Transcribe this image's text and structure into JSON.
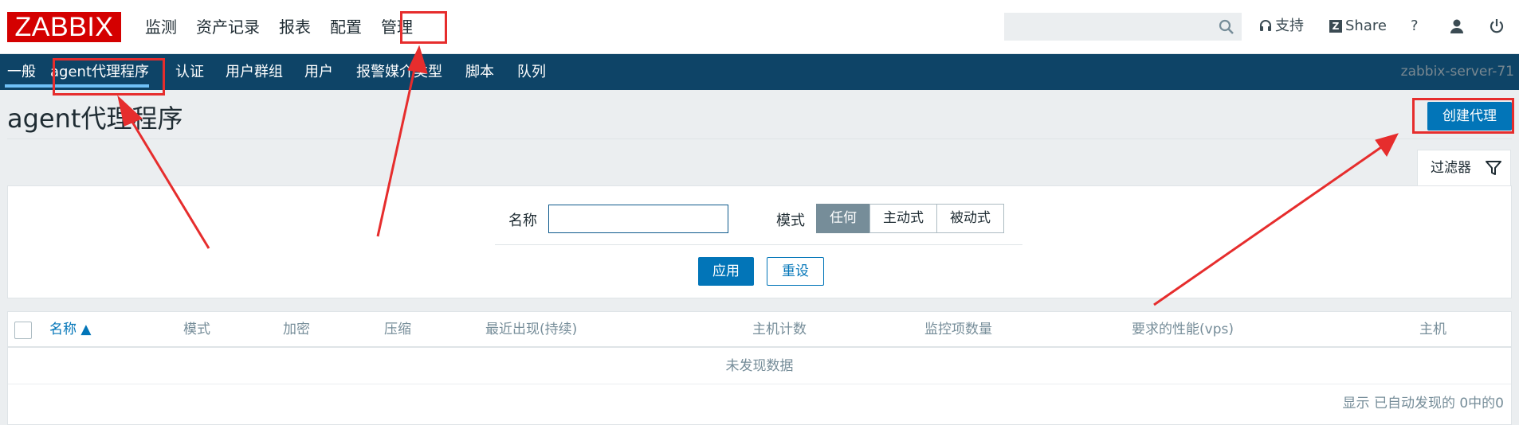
{
  "app": {
    "logo_text": "ZABBIX",
    "server_name": "zabbix-server-71"
  },
  "top_menu": [
    {
      "label": "监测"
    },
    {
      "label": "资产记录"
    },
    {
      "label": "报表"
    },
    {
      "label": "配置"
    },
    {
      "label": "管理",
      "active": true
    }
  ],
  "header_icons": {
    "search_icon": "search-icon",
    "support_label": "支持",
    "share_label": "Share",
    "help_label": "?",
    "user_icon": "user-icon",
    "logout_icon": "power-icon"
  },
  "sub_nav": [
    {
      "label": "一般"
    },
    {
      "label": "agent代理程序",
      "active": true
    },
    {
      "label": "认证"
    },
    {
      "label": "用户群组"
    },
    {
      "label": "用户"
    },
    {
      "label": "报警媒介类型"
    },
    {
      "label": "脚本"
    },
    {
      "label": "队列"
    }
  ],
  "page": {
    "title": "agent代理程序",
    "create_button": "创建代理"
  },
  "filter": {
    "tab_label": "过滤器",
    "name_label": "名称",
    "name_value": "",
    "mode_label": "模式",
    "mode_options": [
      "任何",
      "主动式",
      "被动式"
    ],
    "mode_selected": "任何",
    "apply_label": "应用",
    "reset_label": "重设"
  },
  "table": {
    "columns": [
      "名称 ▲",
      "模式",
      "加密",
      "压缩",
      "最近出现(持续)",
      "主机计数",
      "监控项数量",
      "要求的性能(vps)",
      "主机"
    ],
    "empty_text": "未发现数据",
    "footer": "显示 已自动发现的 0中的0"
  },
  "colors": {
    "logo_bg": "#d40000",
    "nav_bg": "#0e4467",
    "accent": "#0275b8",
    "annotation": "#e62d2d"
  }
}
